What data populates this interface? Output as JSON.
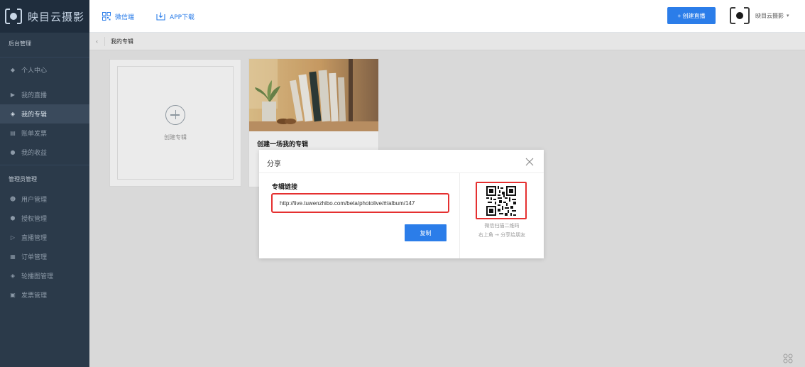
{
  "brand": {
    "name": "映目云摄影",
    "logo_icon": "camera-bracket-logo-icon"
  },
  "topbar": {
    "wechat_label": "微信端",
    "app_label": "APP下载",
    "create_live_label": "+ 创建直播",
    "user_name": "映目云摄影",
    "user_caret": "▾"
  },
  "sidebar": {
    "section_admin": "后台管理",
    "section_manager": "管理员管理",
    "admin_items": [
      {
        "label": "个人中心",
        "icon": "diamond-icon"
      },
      {
        "label": "我的直播",
        "icon": "play-icon"
      },
      {
        "label": "我的专辑",
        "icon": "layers-icon",
        "active": true
      },
      {
        "label": "账单发票",
        "icon": "document-icon"
      },
      {
        "label": "我的收益",
        "icon": "coin-icon"
      }
    ],
    "manager_items": [
      {
        "label": "用户管理",
        "icon": "users-icon"
      },
      {
        "label": "授权管理",
        "icon": "shield-icon"
      },
      {
        "label": "直播管理",
        "icon": "play-icon"
      },
      {
        "label": "订单管理",
        "icon": "clipboard-icon"
      },
      {
        "label": "轮播图管理",
        "icon": "layers-icon"
      },
      {
        "label": "发票管理",
        "icon": "invoice-icon"
      }
    ]
  },
  "breadcrumb": {
    "back": "‹",
    "current": "我的专辑"
  },
  "cards": {
    "create_label": "创建专辑",
    "album_title": "创建一场我的专辑"
  },
  "share_dialog": {
    "title": "分享",
    "link_label": "专辑链接",
    "link_value": "http://live.tuwenzhibo.com/beta/photolive/#/album/147",
    "copy_label": "复制",
    "qr_hint_line1": "微信扫描二维码",
    "qr_hint_line2": "右上角 → 分享给朋友"
  },
  "colors": {
    "accent": "#2b7de9",
    "highlight_border": "#e53030",
    "sidebar_bg": "#2b3a4a",
    "brand_bg": "#1f2d3d"
  }
}
